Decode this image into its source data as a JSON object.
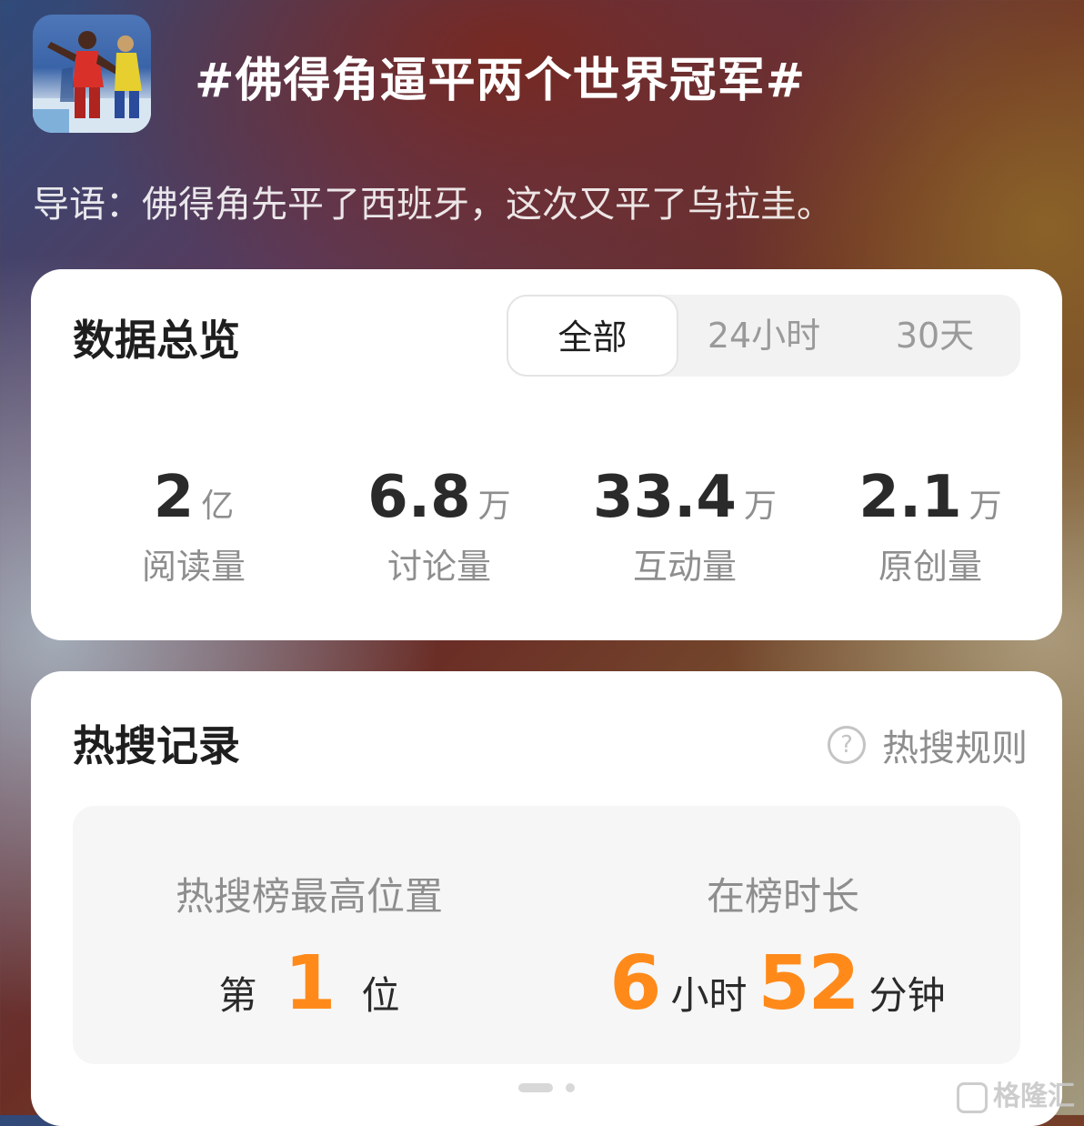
{
  "header": {
    "title": "#佛得角逼平两个世界冠军#",
    "intro": "导语：佛得角先平了西班牙，这次又平了乌拉圭。"
  },
  "overview": {
    "title": "数据总览",
    "tabs": [
      {
        "label": "全部",
        "active": true
      },
      {
        "label": "24小时",
        "active": false
      },
      {
        "label": "30天",
        "active": false
      }
    ],
    "stats": [
      {
        "value": "2",
        "unit": "亿",
        "label": "阅读量"
      },
      {
        "value": "6.8",
        "unit": "万",
        "label": "讨论量"
      },
      {
        "value": "33.4",
        "unit": "万",
        "label": "互动量"
      },
      {
        "value": "2.1",
        "unit": "万",
        "label": "原创量"
      }
    ]
  },
  "hot_search": {
    "title": "热搜记录",
    "rules_label": "热搜规则",
    "rules_icon": "help-circle-icon",
    "highest_position": {
      "label": "热搜榜最高位置",
      "prefix": "第",
      "value": "1",
      "suffix": "位"
    },
    "duration": {
      "label": "在榜时长",
      "hours": "6",
      "hours_unit": "小时",
      "minutes": "52",
      "minutes_unit": "分钟"
    }
  },
  "pager": {
    "current_page": 1,
    "total_pages": 2
  },
  "watermark": {
    "text": "格隆汇"
  },
  "colors": {
    "accent": "#ff8a1a",
    "card_bg": "#ffffff",
    "panel_bg": "#f6f6f6"
  }
}
